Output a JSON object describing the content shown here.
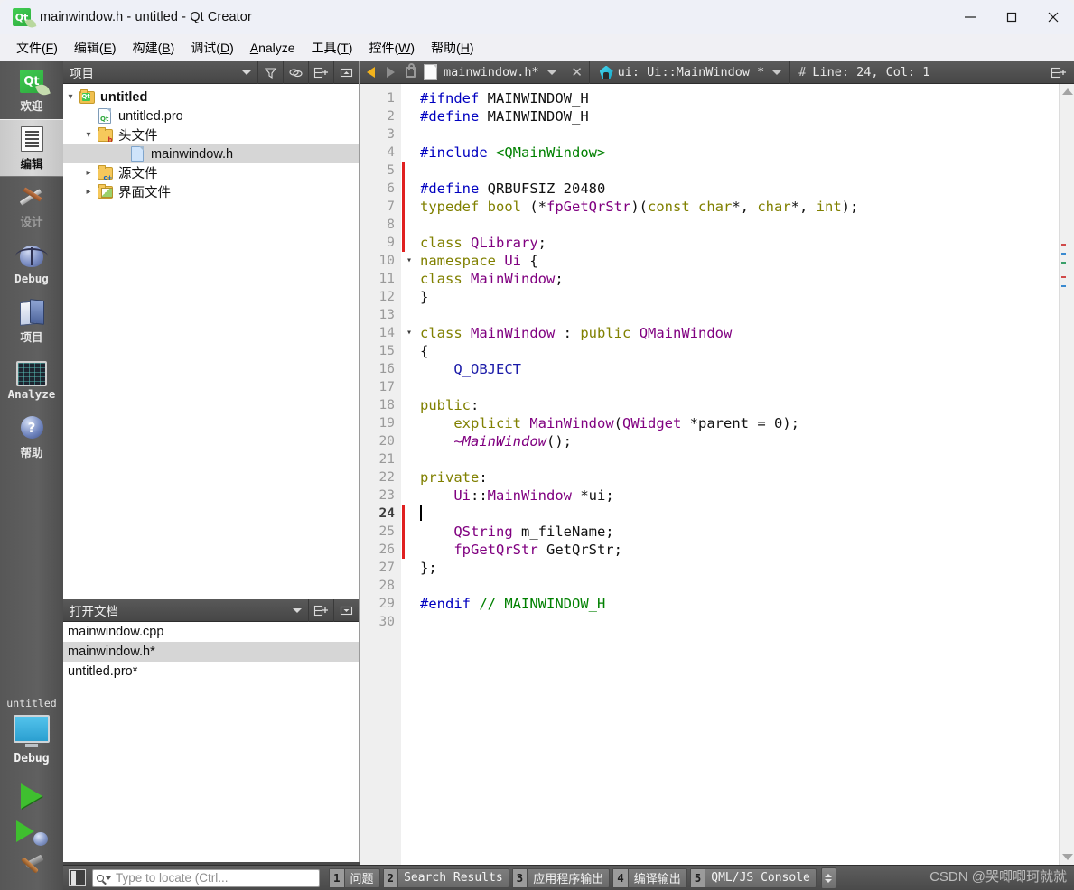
{
  "window": {
    "title": "mainwindow.h - untitled - Qt Creator",
    "app_icon": "qt-logo-icon",
    "controls": {
      "minimize": "—",
      "maximize": "□",
      "close": "✕"
    }
  },
  "menubar": {
    "items": [
      {
        "label": "文件(F)",
        "mnemonic": "F"
      },
      {
        "label": "编辑(E)",
        "mnemonic": "E"
      },
      {
        "label": "构建(B)",
        "mnemonic": "B"
      },
      {
        "label": "调试(D)",
        "mnemonic": "D"
      },
      {
        "label": "Analyze",
        "mnemonic": "A"
      },
      {
        "label": "工具(T)",
        "mnemonic": "T"
      },
      {
        "label": "控件(W)",
        "mnemonic": "W"
      },
      {
        "label": "帮助(H)",
        "mnemonic": "H"
      }
    ]
  },
  "modebar": {
    "modes": [
      {
        "label": "欢迎",
        "icon": "qt-welcome-icon",
        "state": "normal"
      },
      {
        "label": "编辑",
        "icon": "edit-document-icon",
        "state": "active"
      },
      {
        "label": "设计",
        "icon": "design-tools-icon",
        "state": "disabled"
      },
      {
        "label": "Debug",
        "icon": "debug-bug-icon",
        "state": "normal"
      },
      {
        "label": "项目",
        "icon": "projects-books-icon",
        "state": "normal"
      },
      {
        "label": "Analyze",
        "icon": "analyze-monitor-icon",
        "state": "normal"
      },
      {
        "label": "帮助",
        "icon": "help-question-icon",
        "state": "normal"
      }
    ],
    "kit": {
      "project": "untitled",
      "build_config": "Debug",
      "target_icon": "desktop-monitor-icon",
      "run_button": "run-play-icon",
      "debug_button": "run-debug-icon",
      "build_button": "build-hammer-icon"
    }
  },
  "projects_dock": {
    "title": "项目",
    "header_buttons": [
      "filter-icon",
      "link-sync-icon",
      "split-add-icon",
      "collapse-icon"
    ],
    "tree": [
      {
        "label": "untitled",
        "icon": "qt-project-folder-icon",
        "depth": 0,
        "arrow": "expanded",
        "bold": true,
        "selected": false
      },
      {
        "label": "untitled.pro",
        "icon": "qt-pro-file-icon",
        "depth": 1,
        "arrow": "none",
        "bold": false,
        "selected": false
      },
      {
        "label": "头文件",
        "icon": "headers-folder-icon",
        "depth": 1,
        "arrow": "expanded",
        "bold": false,
        "selected": false
      },
      {
        "label": "mainwindow.h",
        "icon": "header-file-icon",
        "depth": 2,
        "arrow": "none",
        "bold": false,
        "selected": true
      },
      {
        "label": "源文件",
        "icon": "sources-folder-icon",
        "depth": 1,
        "arrow": "collapsed",
        "bold": false,
        "selected": false
      },
      {
        "label": "界面文件",
        "icon": "forms-folder-icon",
        "depth": 1,
        "arrow": "collapsed",
        "bold": false,
        "selected": false
      }
    ]
  },
  "opendocs_dock": {
    "title": "打开文档",
    "header_buttons": [
      "split-add-icon",
      "collapse-icon"
    ],
    "documents": [
      {
        "label": "mainwindow.cpp",
        "selected": false
      },
      {
        "label": "mainwindow.h*",
        "selected": true
      },
      {
        "label": "untitled.pro*",
        "selected": false
      }
    ]
  },
  "editor_toolbar": {
    "back_icon": "navigate-back-icon",
    "forward_icon": "navigate-forward-icon",
    "lock_icon": "unlocked-padlock-icon",
    "file_name": "mainwindow.h*",
    "file_icon": "document-icon",
    "close_label": "✕",
    "symbol_icon": "qt-symbol-icon",
    "symbol_name": "ui: Ui::MainWindow *",
    "cursor_hash": "#",
    "cursor_position": "Line: 24, Col: 1",
    "split_icon": "split-editor-icon"
  },
  "editor": {
    "language": "cpp",
    "lines": [
      {
        "n": 1,
        "fold": "",
        "change": false,
        "tokens": [
          {
            "t": "#ifndef",
            "c": "pp"
          },
          {
            "t": " ",
            "c": "plain"
          },
          {
            "t": "MAINWINDOW_H",
            "c": "plain"
          }
        ]
      },
      {
        "n": 2,
        "fold": "",
        "change": false,
        "tokens": [
          {
            "t": "#define",
            "c": "pp"
          },
          {
            "t": " ",
            "c": "plain"
          },
          {
            "t": "MAINWINDOW_H",
            "c": "plain"
          }
        ]
      },
      {
        "n": 3,
        "fold": "",
        "change": false,
        "tokens": []
      },
      {
        "n": 4,
        "fold": "",
        "change": false,
        "tokens": [
          {
            "t": "#include",
            "c": "pp"
          },
          {
            "t": " ",
            "c": "plain"
          },
          {
            "t": "<QMainWindow>",
            "c": "str"
          }
        ]
      },
      {
        "n": 5,
        "fold": "",
        "change": true,
        "tokens": []
      },
      {
        "n": 6,
        "fold": "",
        "change": true,
        "tokens": [
          {
            "t": "#define",
            "c": "pp"
          },
          {
            "t": " ",
            "c": "plain"
          },
          {
            "t": "QRBUFSIZ",
            "c": "plain"
          },
          {
            "t": " 20480",
            "c": "plain"
          }
        ]
      },
      {
        "n": 7,
        "fold": "",
        "change": true,
        "tokens": [
          {
            "t": "typedef",
            "c": "kw"
          },
          {
            "t": " ",
            "c": "plain"
          },
          {
            "t": "bool",
            "c": "kw"
          },
          {
            "t": " (*",
            "c": "plain"
          },
          {
            "t": "fpGetQrStr",
            "c": "type"
          },
          {
            "t": ")(",
            "c": "plain"
          },
          {
            "t": "const",
            "c": "kw"
          },
          {
            "t": " ",
            "c": "plain"
          },
          {
            "t": "char",
            "c": "kw"
          },
          {
            "t": "*, ",
            "c": "plain"
          },
          {
            "t": "char",
            "c": "kw"
          },
          {
            "t": "*, ",
            "c": "plain"
          },
          {
            "t": "int",
            "c": "kw"
          },
          {
            "t": ");",
            "c": "plain"
          }
        ]
      },
      {
        "n": 8,
        "fold": "",
        "change": true,
        "tokens": []
      },
      {
        "n": 9,
        "fold": "",
        "change": true,
        "tokens": [
          {
            "t": "class",
            "c": "kw"
          },
          {
            "t": " ",
            "c": "plain"
          },
          {
            "t": "QLibrary",
            "c": "type"
          },
          {
            "t": ";",
            "c": "plain"
          }
        ]
      },
      {
        "n": 10,
        "fold": "v",
        "change": false,
        "tokens": [
          {
            "t": "namespace",
            "c": "kw"
          },
          {
            "t": " ",
            "c": "plain"
          },
          {
            "t": "Ui",
            "c": "type"
          },
          {
            "t": " {",
            "c": "plain"
          }
        ]
      },
      {
        "n": 11,
        "fold": "",
        "change": false,
        "tokens": [
          {
            "t": "class",
            "c": "kw"
          },
          {
            "t": " ",
            "c": "plain"
          },
          {
            "t": "MainWindow",
            "c": "type"
          },
          {
            "t": ";",
            "c": "plain"
          }
        ]
      },
      {
        "n": 12,
        "fold": "",
        "change": false,
        "tokens": [
          {
            "t": "}",
            "c": "plain"
          }
        ]
      },
      {
        "n": 13,
        "fold": "",
        "change": false,
        "tokens": []
      },
      {
        "n": 14,
        "fold": "v",
        "change": false,
        "tokens": [
          {
            "t": "class",
            "c": "kw"
          },
          {
            "t": " ",
            "c": "plain"
          },
          {
            "t": "MainWindow",
            "c": "type"
          },
          {
            "t": " : ",
            "c": "plain"
          },
          {
            "t": "public",
            "c": "kw"
          },
          {
            "t": " ",
            "c": "plain"
          },
          {
            "t": "QMainWindow",
            "c": "type"
          }
        ]
      },
      {
        "n": 15,
        "fold": "",
        "change": false,
        "tokens": [
          {
            "t": "{",
            "c": "plain"
          }
        ]
      },
      {
        "n": 16,
        "fold": "",
        "change": false,
        "tokens": [
          {
            "t": "    ",
            "c": "plain"
          },
          {
            "t": "Q_OBJECT",
            "c": "macro"
          }
        ]
      },
      {
        "n": 17,
        "fold": "",
        "change": false,
        "tokens": []
      },
      {
        "n": 18,
        "fold": "",
        "change": false,
        "tokens": [
          {
            "t": "public",
            "c": "kw"
          },
          {
            "t": ":",
            "c": "plain"
          }
        ]
      },
      {
        "n": 19,
        "fold": "",
        "change": false,
        "tokens": [
          {
            "t": "    ",
            "c": "plain"
          },
          {
            "t": "explicit",
            "c": "kw"
          },
          {
            "t": " ",
            "c": "plain"
          },
          {
            "t": "MainWindow",
            "c": "type"
          },
          {
            "t": "(",
            "c": "plain"
          },
          {
            "t": "QWidget",
            "c": "type"
          },
          {
            "t": " *parent = ",
            "c": "plain"
          },
          {
            "t": "0",
            "c": "plain"
          },
          {
            "t": ");",
            "c": "plain"
          }
        ]
      },
      {
        "n": 20,
        "fold": "",
        "change": false,
        "tokens": [
          {
            "t": "    ",
            "c": "plain"
          },
          {
            "t": "~MainWindow",
            "c": "ital"
          },
          {
            "t": "();",
            "c": "plain"
          }
        ]
      },
      {
        "n": 21,
        "fold": "",
        "change": false,
        "tokens": []
      },
      {
        "n": 22,
        "fold": "",
        "change": false,
        "tokens": [
          {
            "t": "private",
            "c": "kw"
          },
          {
            "t": ":",
            "c": "plain"
          }
        ]
      },
      {
        "n": 23,
        "fold": "",
        "change": false,
        "tokens": [
          {
            "t": "    ",
            "c": "plain"
          },
          {
            "t": "Ui",
            "c": "type"
          },
          {
            "t": "::",
            "c": "plain"
          },
          {
            "t": "MainWindow",
            "c": "type"
          },
          {
            "t": " *ui;",
            "c": "plain"
          }
        ]
      },
      {
        "n": 24,
        "fold": "",
        "change": true,
        "current": true,
        "caret": true,
        "tokens": []
      },
      {
        "n": 25,
        "fold": "",
        "change": true,
        "tokens": [
          {
            "t": "    ",
            "c": "plain"
          },
          {
            "t": "QString",
            "c": "type"
          },
          {
            "t": " m_fileName;",
            "c": "plain"
          }
        ]
      },
      {
        "n": 26,
        "fold": "",
        "change": true,
        "tokens": [
          {
            "t": "    ",
            "c": "plain"
          },
          {
            "t": "fpGetQrStr",
            "c": "type"
          },
          {
            "t": " GetQrStr;",
            "c": "plain"
          }
        ]
      },
      {
        "n": 27,
        "fold": "",
        "change": false,
        "tokens": [
          {
            "t": "};",
            "c": "plain"
          }
        ]
      },
      {
        "n": 28,
        "fold": "",
        "change": false,
        "tokens": []
      },
      {
        "n": 29,
        "fold": "",
        "change": false,
        "tokens": [
          {
            "t": "#endif",
            "c": "pp"
          },
          {
            "t": " ",
            "c": "plain"
          },
          {
            "t": "// MAINWINDOW_H",
            "c": "com"
          }
        ]
      },
      {
        "n": 30,
        "fold": "",
        "change": false,
        "tokens": []
      }
    ]
  },
  "statusbar": {
    "sidebar_toggle_icon": "toggle-sidebar-icon",
    "locator": {
      "icon": "search-magnifier-icon",
      "placeholder": "Type to locate (Ctrl...",
      "value": ""
    },
    "output_panes": [
      {
        "num": "1",
        "label": "问题"
      },
      {
        "num": "2",
        "label": "Search Results"
      },
      {
        "num": "3",
        "label": "应用程序输出"
      },
      {
        "num": "4",
        "label": "编译输出"
      },
      {
        "num": "5",
        "label": "QML/JS Console"
      }
    ],
    "spinner_icon": "updown-spinner-icon"
  },
  "watermark": {
    "text": "CSDN @哭唧唧珂就就"
  },
  "colors": {
    "accent_qt_green": "#41cd52",
    "chrome_dark": "#4a4a4a",
    "selection_gray": "#d6d6d6",
    "changebar_red": "#e02020",
    "keyword": "#808000",
    "preprocessor": "#0000c0",
    "type": "#800080",
    "string": "#008000",
    "comment": "#008000"
  }
}
